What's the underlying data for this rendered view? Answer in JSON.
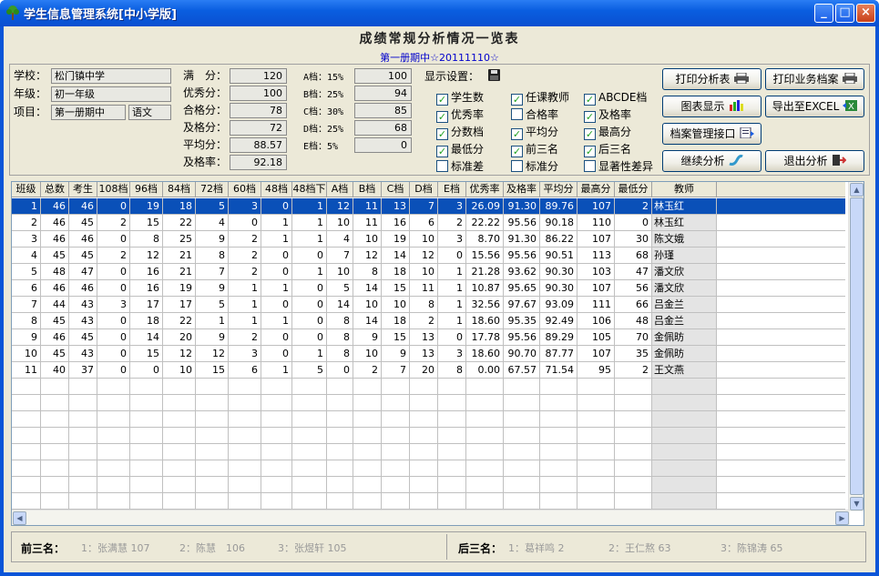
{
  "window": {
    "title": "学生信息管理系统[中小学版]",
    "min": "_",
    "max": "□",
    "close": "×"
  },
  "report": {
    "title": "成绩常规分析情况一览表",
    "subtitle": "第一册期中☆20111110☆"
  },
  "info": {
    "school_label": "学校：",
    "school": "松门镇中学",
    "grade_label": "年级：",
    "grade": "初一年级",
    "item_label": "项目：",
    "exam": "第一册期中",
    "subject": "语文"
  },
  "scores": [
    {
      "label": "满　分：",
      "value": "120"
    },
    {
      "label": "优秀分：",
      "value": "100"
    },
    {
      "label": "合格分：",
      "value": "78"
    },
    {
      "label": "及格分：",
      "value": "72"
    },
    {
      "label": "平均分：",
      "value": "88.57"
    },
    {
      "label": "及格率：",
      "value": "92.18"
    }
  ],
  "levels": [
    {
      "label": "A档：15%",
      "value": "100"
    },
    {
      "label": "B档：25%",
      "value": "94"
    },
    {
      "label": "C档：30%",
      "value": "85"
    },
    {
      "label": "D档：25%",
      "value": "68"
    },
    {
      "label": "E档：5%",
      "value": "0"
    }
  ],
  "display": {
    "label": "显示设置：",
    "save_icon": "floppy-disk-icon",
    "options": [
      {
        "label": "学生数",
        "checked": true
      },
      {
        "label": "任课教师",
        "checked": true
      },
      {
        "label": "ABCDE档",
        "checked": true
      },
      {
        "label": "优秀率",
        "checked": true
      },
      {
        "label": "合格率",
        "checked": false
      },
      {
        "label": "及格率",
        "checked": true
      },
      {
        "label": "分数档",
        "checked": true
      },
      {
        "label": "平均分",
        "checked": true
      },
      {
        "label": "最高分",
        "checked": true
      },
      {
        "label": "最低分",
        "checked": true
      },
      {
        "label": "前三名",
        "checked": true
      },
      {
        "label": "后三名",
        "checked": true
      },
      {
        "label": "标准差",
        "checked": false
      },
      {
        "label": "标准分",
        "checked": false
      },
      {
        "label": "显著性差异",
        "checked": false
      }
    ]
  },
  "buttons": {
    "print_table": "打印分析表",
    "print_archive": "打印业务档案",
    "chart": "图表显示",
    "export": "导出至EXCEL",
    "archive_api": "档案管理接口",
    "continue": "继续分析",
    "exit": "退出分析"
  },
  "table": {
    "columns": [
      "班级",
      "总数",
      "考生",
      "108档",
      "96档",
      "84档",
      "72档",
      "60档",
      "48档",
      "48档下",
      "A档",
      "B档",
      "C档",
      "D档",
      "E档",
      "优秀率",
      "及格率",
      "平均分",
      "最高分",
      "最低分",
      "教师"
    ],
    "rows": [
      [
        "1",
        "46",
        "46",
        "0",
        "19",
        "18",
        "5",
        "3",
        "0",
        "1",
        "12",
        "11",
        "13",
        "7",
        "3",
        "26.09",
        "91.30",
        "89.76",
        "107",
        "2",
        "林玉红"
      ],
      [
        "2",
        "46",
        "45",
        "2",
        "15",
        "22",
        "4",
        "0",
        "1",
        "1",
        "10",
        "11",
        "16",
        "6",
        "2",
        "22.22",
        "95.56",
        "90.18",
        "110",
        "0",
        "林玉红"
      ],
      [
        "3",
        "46",
        "46",
        "0",
        "8",
        "25",
        "9",
        "2",
        "1",
        "1",
        "4",
        "10",
        "19",
        "10",
        "3",
        "8.70",
        "91.30",
        "86.22",
        "107",
        "30",
        "陈文娥"
      ],
      [
        "4",
        "45",
        "45",
        "2",
        "12",
        "21",
        "8",
        "2",
        "0",
        "0",
        "7",
        "12",
        "14",
        "12",
        "0",
        "15.56",
        "95.56",
        "90.51",
        "113",
        "68",
        "孙瑾"
      ],
      [
        "5",
        "48",
        "47",
        "0",
        "16",
        "21",
        "7",
        "2",
        "0",
        "1",
        "10",
        "8",
        "18",
        "10",
        "1",
        "21.28",
        "93.62",
        "90.30",
        "103",
        "47",
        "潘文欣"
      ],
      [
        "6",
        "46",
        "46",
        "0",
        "16",
        "19",
        "9",
        "1",
        "1",
        "0",
        "5",
        "14",
        "15",
        "11",
        "1",
        "10.87",
        "95.65",
        "90.30",
        "107",
        "56",
        "潘文欣"
      ],
      [
        "7",
        "44",
        "43",
        "3",
        "17",
        "17",
        "5",
        "1",
        "0",
        "0",
        "14",
        "10",
        "10",
        "8",
        "1",
        "32.56",
        "97.67",
        "93.09",
        "111",
        "66",
        "吕金兰"
      ],
      [
        "8",
        "45",
        "43",
        "0",
        "18",
        "22",
        "1",
        "1",
        "1",
        "0",
        "8",
        "14",
        "18",
        "2",
        "1",
        "18.60",
        "95.35",
        "92.49",
        "106",
        "48",
        "吕金兰"
      ],
      [
        "9",
        "46",
        "45",
        "0",
        "14",
        "20",
        "9",
        "2",
        "0",
        "0",
        "8",
        "9",
        "15",
        "13",
        "0",
        "17.78",
        "95.56",
        "89.29",
        "105",
        "70",
        "金佩昉"
      ],
      [
        "10",
        "45",
        "43",
        "0",
        "15",
        "12",
        "12",
        "3",
        "0",
        "1",
        "8",
        "10",
        "9",
        "13",
        "3",
        "18.60",
        "90.70",
        "87.77",
        "107",
        "35",
        "金佩昉"
      ],
      [
        "11",
        "40",
        "37",
        "0",
        "0",
        "10",
        "15",
        "6",
        "1",
        "5",
        "0",
        "2",
        "7",
        "20",
        "8",
        "0.00",
        "67.57",
        "71.54",
        "95",
        "2",
        "王文燕"
      ]
    ]
  },
  "footer": {
    "top_label": "前三名：",
    "top": [
      "1：张满慧 107",
      "2：陈慧　106",
      "3：张煜轩 105"
    ],
    "bottom_label": "后三名：",
    "bottom": [
      "1：葛祥鸣 2",
      "2：王仁熬 63",
      "3：陈锦涛 65"
    ]
  }
}
